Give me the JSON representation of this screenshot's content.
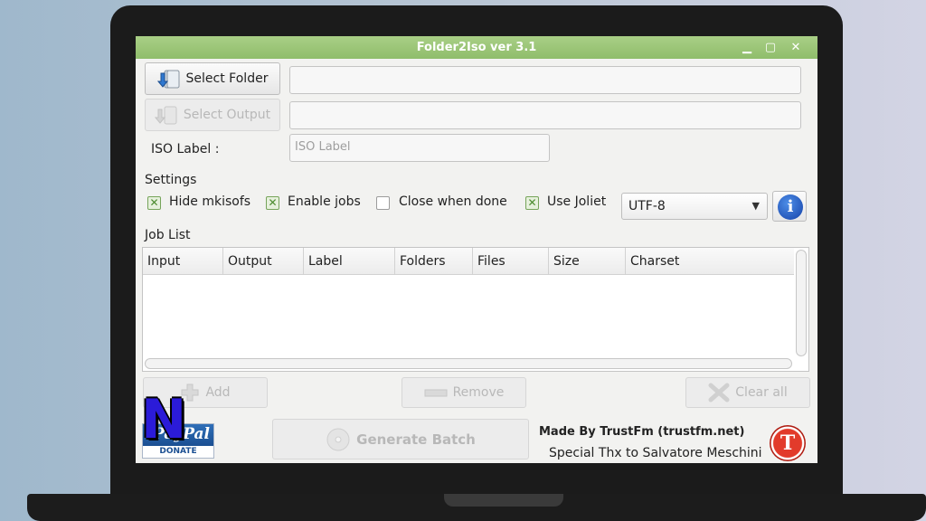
{
  "window": {
    "title": "Folder2Iso ver 3.1",
    "minimize_glyph": "▁",
    "maximize_glyph": "▢",
    "close_glyph": "✕"
  },
  "buttons": {
    "select_folder": "Select Folder",
    "select_output": "Select Output",
    "add": "Add",
    "remove": "Remove",
    "clear_all": "Clear all",
    "generate_batch": "Generate Batch"
  },
  "fields": {
    "folder_value": "",
    "output_value": "",
    "iso_label_placeholder": "ISO Label"
  },
  "labels": {
    "iso_label": "ISO Label :",
    "settings": "Settings",
    "job_list": "Job List"
  },
  "settings": {
    "options": [
      {
        "label": "Hide mkisofs",
        "checked": true
      },
      {
        "label": "Enable jobs",
        "checked": true
      },
      {
        "label": "Close when done",
        "checked": false
      },
      {
        "label": "Use Joliet",
        "checked": true
      }
    ],
    "charset": "UTF-8"
  },
  "job_table": {
    "columns": [
      "Input",
      "Output",
      "Label",
      "Folders",
      "Files",
      "Size",
      "Charset"
    ],
    "rows": []
  },
  "footer": {
    "made_by": "Made By TrustFm (trustfm.net)",
    "thanks": "Special Thx to Salvatore Meschini",
    "donate_brand": "PayPal",
    "donate_label": "DONATE",
    "trustfm_logo_letter": "T",
    "watermark_letter": "N"
  },
  "colors": {
    "titlebar": "#97c474",
    "window_bg": "#f2f2f0",
    "info_icon": "#1e5bc6",
    "trustfm_logo": "#d8281b",
    "watermark": "#2b1bd8"
  },
  "icons": {
    "select_folder": "folder-arrow-icon",
    "info": "info-icon",
    "add": "plus-icon",
    "remove": "minus-icon",
    "clear_all": "x-icon",
    "generate_batch": "disc-icon"
  }
}
